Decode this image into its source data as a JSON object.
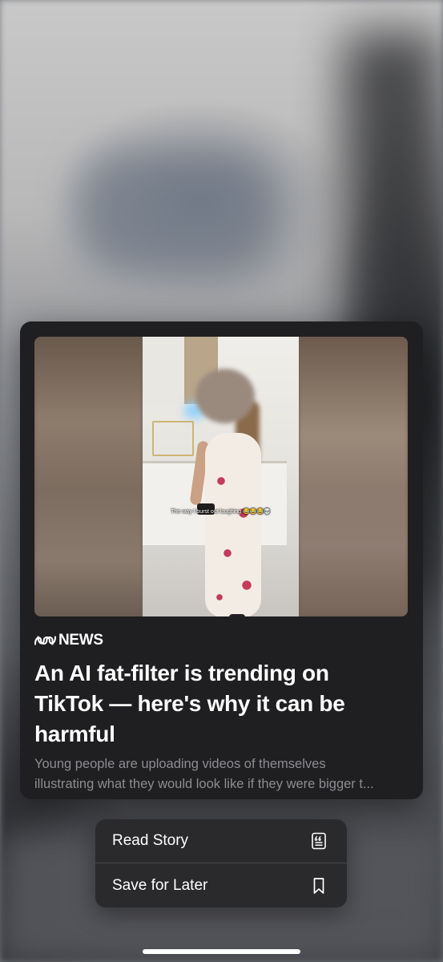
{
  "article": {
    "source": "NEWS",
    "headline": "An AI fat-filter is trending on TikTok — here's why it can be harmful",
    "summary_line1": "Young people are uploading videos of themselves",
    "summary_line2": "illustrating what they would look like if they were bigger t...",
    "image_caption": "The way I burst out laughing 😂😂😂💀"
  },
  "menu": {
    "items": [
      {
        "label": "Read Story",
        "icon": "article-quote-icon"
      },
      {
        "label": "Save for Later",
        "icon": "bookmark-icon"
      }
    ]
  },
  "colors": {
    "card_bg": "#1f1f21",
    "menu_bg": "#2a2a2d",
    "summary_text": "#8d8d92"
  }
}
